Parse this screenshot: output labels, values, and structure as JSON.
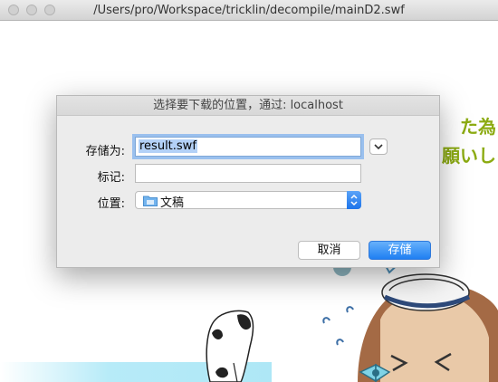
{
  "window": {
    "title": "/Users/pro/Workspace/tricklin/decompile/mainD2.swf"
  },
  "background": {
    "text_line1": "た為",
    "text_line2": "願いし",
    "accent_color": "#8cab12"
  },
  "dialog": {
    "title": "选择要下载的位置，通过: localhost",
    "save_as_label": "存储为:",
    "save_as_value": "result.swf",
    "tags_label": "标记:",
    "tags_value": "",
    "where_label": "位置:",
    "where_value": "文稿",
    "where_icon": "folder-icon",
    "cancel_label": "取消",
    "save_label": "存储",
    "accent_color": "#1f7ff2"
  }
}
